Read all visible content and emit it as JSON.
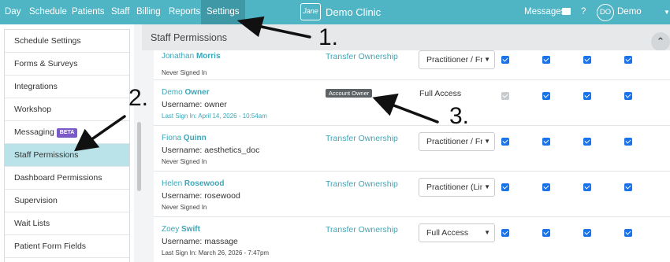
{
  "nav": {
    "items": [
      {
        "label": "Day"
      },
      {
        "label": "Schedule"
      },
      {
        "label": "Patients"
      },
      {
        "label": "Staff"
      },
      {
        "label": "Billing"
      },
      {
        "label": "Reports"
      },
      {
        "label": "Settings",
        "active": true
      }
    ],
    "clinic_name": "Demo Clinic",
    "messages_label": "Messages",
    "help_label": "?",
    "avatar_initials": "DO",
    "user_name": "Demo Owner"
  },
  "sidebar": {
    "items": [
      {
        "label": "Schedule Settings"
      },
      {
        "label": "Forms & Surveys"
      },
      {
        "label": "Integrations"
      },
      {
        "label": "Workshop"
      },
      {
        "label": "Messaging",
        "badge": "BETA"
      },
      {
        "label": "Staff Permissions",
        "active": true
      },
      {
        "label": "Dashboard Permissions"
      },
      {
        "label": "Supervision"
      },
      {
        "label": "Wait Lists"
      },
      {
        "label": "Patient Form Fields"
      }
    ]
  },
  "main": {
    "title": "Staff Permissions",
    "rows": [
      {
        "first": "Jonathan",
        "last": "Morris",
        "username": "",
        "signin": "Never Signed In",
        "action": "Transfer Ownership",
        "access": "Practitioner / Fr",
        "perms": [
          true,
          true,
          true,
          true
        ]
      },
      {
        "first": "Demo",
        "last": "Owner",
        "username": "Username: owner",
        "signin": "Last Sign In: April 14, 2026 - 10:54am",
        "badge": "Account Owner",
        "access": "Full Access",
        "perms": [
          true,
          true,
          true,
          true
        ],
        "first_disabled": true
      },
      {
        "first": "Fiona",
        "last": "Quinn",
        "username": "Username: aesthetics_doc",
        "signin": "Never Signed In",
        "action": "Transfer Ownership",
        "access": "Practitioner / Fr",
        "perms": [
          true,
          true,
          true,
          true
        ]
      },
      {
        "first": "Helen",
        "last": "Rosewood",
        "username": "Username: rosewood",
        "signin": "Never Signed In",
        "action": "Transfer Ownership",
        "access": "Practitioner (Lin",
        "perms": [
          true,
          true,
          true,
          true
        ]
      },
      {
        "first": "Zoey",
        "last": "Swift",
        "username": "Username: massage",
        "signin": "Last Sign In: March 26, 2026 - 7:47pm",
        "action": "Transfer Ownership",
        "access": "Full Access",
        "perms": [
          true,
          true,
          true,
          true
        ]
      }
    ]
  },
  "annotations": {
    "step1": "1.",
    "step2": "2.",
    "step3": "3."
  },
  "colors": {
    "topbar": "#4fb4c3",
    "active_tab": "#3e98a6",
    "link": "#3aa7b8",
    "active_side": "#b9e3e8",
    "checkbox": "#1a73e8",
    "beta": "#7b5ac8"
  }
}
